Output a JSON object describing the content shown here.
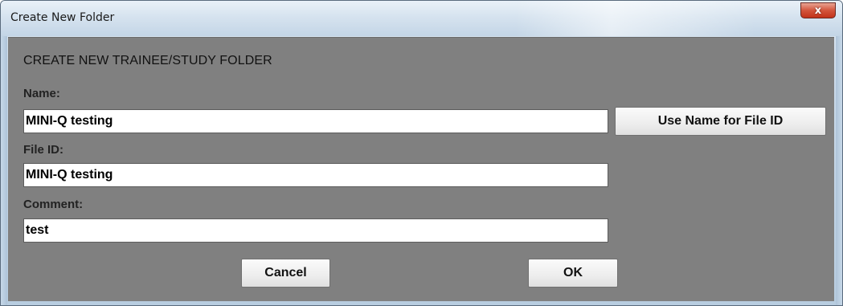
{
  "window": {
    "title": "Create New Folder",
    "close_symbol": "x"
  },
  "dialog": {
    "heading": "CREATE NEW TRAINEE/STUDY FOLDER",
    "name_label": "Name:",
    "name_value": "MINI-Q testing",
    "use_name_button": "Use Name for File ID",
    "file_id_label": "File ID:",
    "file_id_value": "MINI-Q testing",
    "comment_label": "Comment:",
    "comment_value": "test",
    "cancel_button": "Cancel",
    "ok_button": "OK"
  },
  "colors": {
    "panel_background": "#808080",
    "close_button": "#c7452c"
  },
  "icons": {
    "close": "close-icon"
  }
}
